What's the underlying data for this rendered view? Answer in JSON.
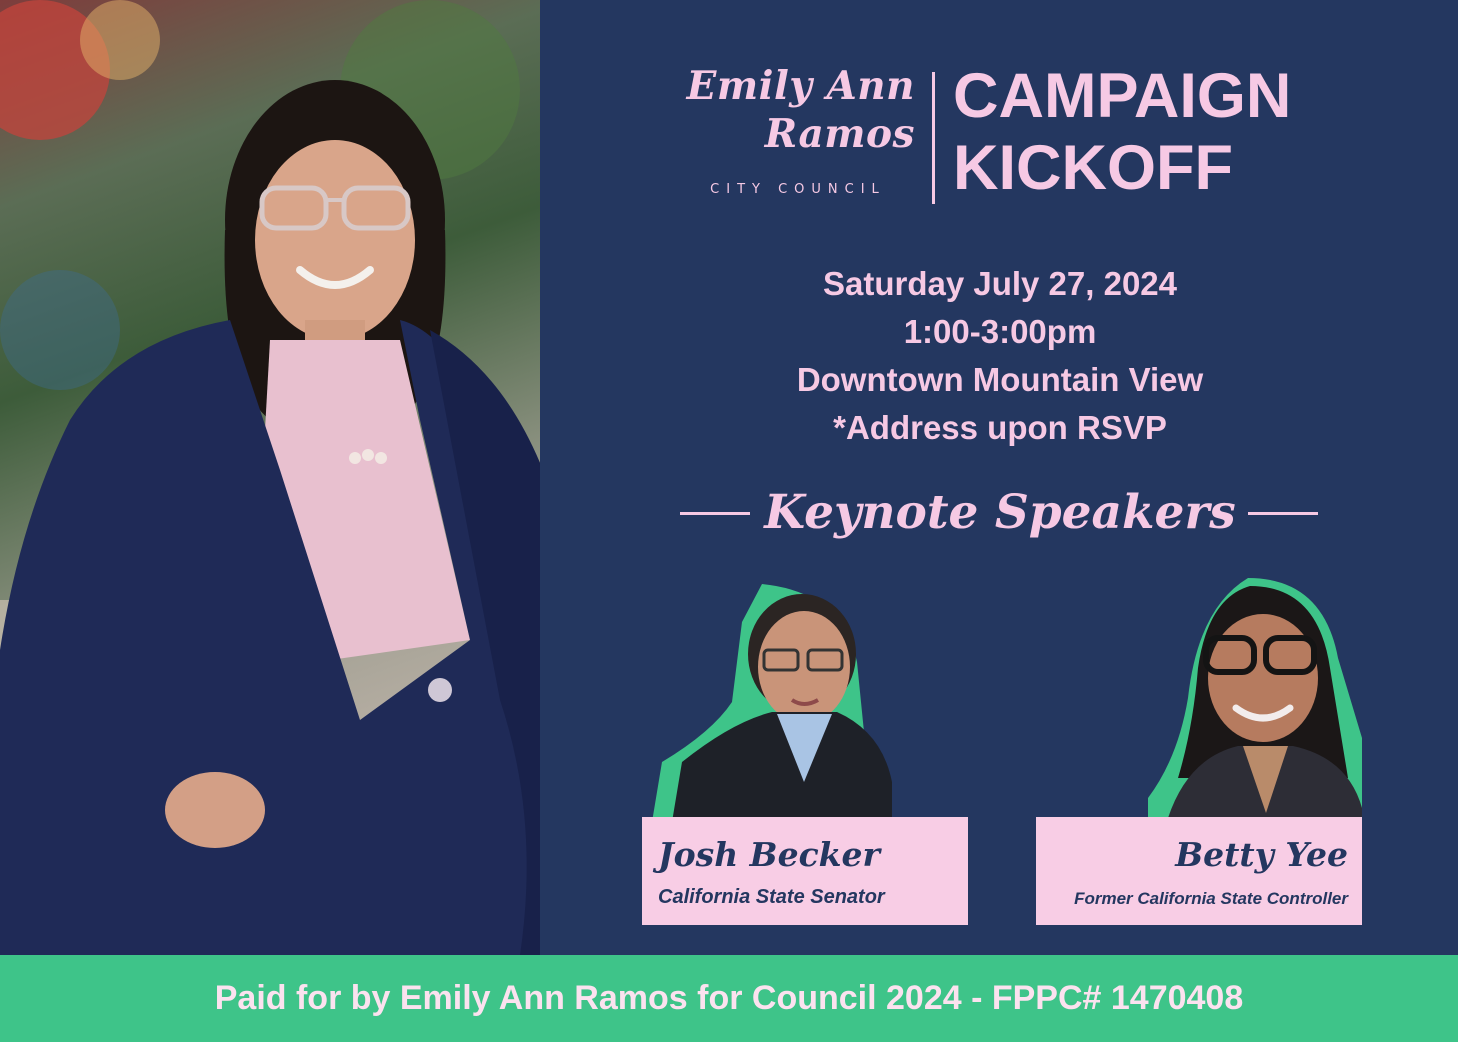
{
  "logo": {
    "name_line1": "Emily Ann",
    "name_line2": "Ramos",
    "subtitle": "CITY COUNCIL"
  },
  "event": {
    "title_line1": "CAMPAIGN",
    "title_line2": "KICKOFF",
    "date": "Saturday July 27, 2024",
    "time": "1:00-3:00pm",
    "location": "Downtown Mountain View",
    "address_note": "*Address upon RSVP"
  },
  "keynote": {
    "heading": "Keynote Speakers",
    "speakers": [
      {
        "name": "Josh Becker",
        "role": "California State Senator"
      },
      {
        "name": "Betty Yee",
        "role": "Former California  State Controller"
      }
    ]
  },
  "footer": {
    "disclaimer": "Paid for by Emily Ann Ramos for Council 2024 - FPPC# 1470408"
  },
  "colors": {
    "background": "#243760",
    "accent_pink": "#f6c9e4",
    "accent_green": "#3ec489"
  }
}
